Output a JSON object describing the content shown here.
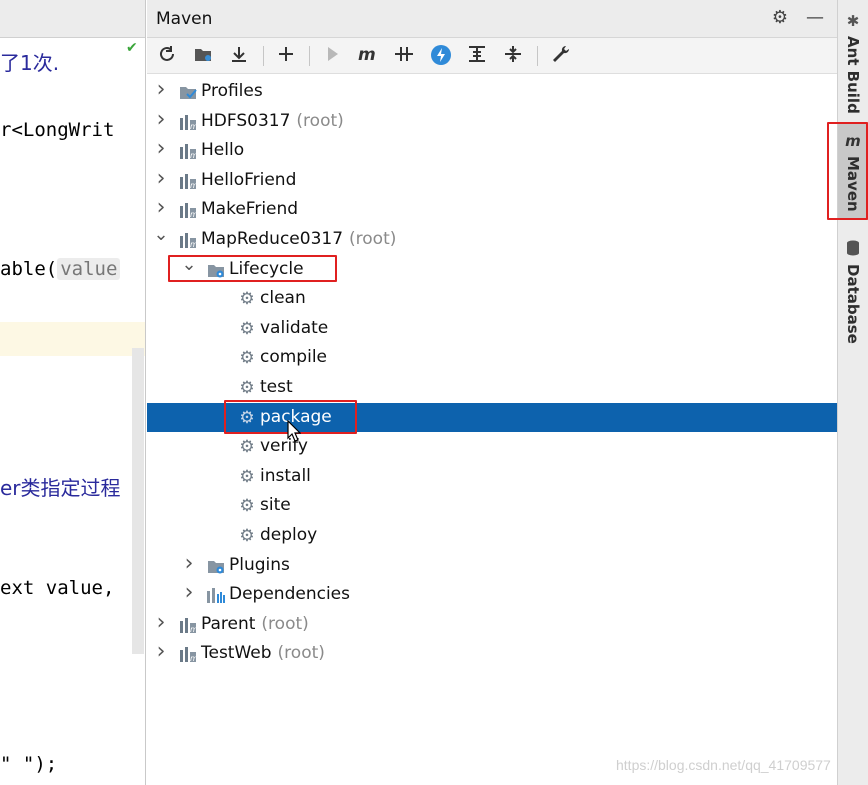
{
  "editor": {
    "lines": [
      {
        "text": "了1次.",
        "kind": "comment"
      },
      {
        "text": "r<LongWrit",
        "kind": "code"
      },
      {
        "text": "able(",
        "kind": "code",
        "hint": "value"
      },
      {
        "text": "er类指定过程",
        "kind": "comment"
      },
      {
        "text": "ext value,",
        "kind": "code"
      },
      {
        "text": "\" \");",
        "kind": "code"
      }
    ]
  },
  "maven": {
    "title": "Maven",
    "header_buttons": [
      {
        "name": "settings-gear-icon",
        "glyph": "⚙"
      },
      {
        "name": "hide-icon",
        "glyph": "—"
      }
    ],
    "toolbar": [
      {
        "name": "reimport-icon",
        "glyph": "⟳"
      },
      {
        "name": "generate-sources-icon",
        "glyph": "▣"
      },
      {
        "name": "download-icon",
        "glyph": "⤓"
      },
      {
        "name": "add-maven-project-icon",
        "glyph": "+"
      },
      {
        "name": "run-icon",
        "glyph": "▶"
      },
      {
        "name": "execute-goal-icon",
        "glyph": "m"
      },
      {
        "name": "toggle-offline-icon",
        "glyph": "⧸⧸"
      },
      {
        "name": "skip-tests-icon",
        "glyph": "⚡"
      },
      {
        "name": "show-dependencies-icon",
        "glyph": "⊤"
      },
      {
        "name": "collapse-all-icon",
        "glyph": "≑"
      },
      {
        "name": "maven-settings-icon",
        "glyph": "🔧"
      }
    ],
    "tree": [
      {
        "label": "Profiles",
        "suffix": "",
        "level": 0,
        "arrow": "›",
        "icon": "profiles"
      },
      {
        "label": "HDFS0317",
        "suffix": "(root)",
        "level": 0,
        "arrow": "›",
        "icon": "module"
      },
      {
        "label": "Hello",
        "suffix": "",
        "level": 0,
        "arrow": "›",
        "icon": "module"
      },
      {
        "label": "HelloFriend",
        "suffix": "",
        "level": 0,
        "arrow": "›",
        "icon": "module"
      },
      {
        "label": "MakeFriend",
        "suffix": "",
        "level": 0,
        "arrow": "›",
        "icon": "module"
      },
      {
        "label": "MapReduce0317",
        "suffix": "(root)",
        "level": 0,
        "arrow": "⌄",
        "icon": "module"
      },
      {
        "label": "Lifecycle",
        "suffix": "",
        "level": 1,
        "arrow": "⌄",
        "icon": "folder-gear"
      },
      {
        "label": "clean",
        "suffix": "",
        "level": 2,
        "arrow": "",
        "icon": "gear"
      },
      {
        "label": "validate",
        "suffix": "",
        "level": 2,
        "arrow": "",
        "icon": "gear"
      },
      {
        "label": "compile",
        "suffix": "",
        "level": 2,
        "arrow": "",
        "icon": "gear"
      },
      {
        "label": "test",
        "suffix": "",
        "level": 2,
        "arrow": "",
        "icon": "gear"
      },
      {
        "label": "package",
        "suffix": "",
        "level": 2,
        "arrow": "",
        "icon": "gear",
        "selected": true
      },
      {
        "label": "verify",
        "suffix": "",
        "level": 2,
        "arrow": "",
        "icon": "gear"
      },
      {
        "label": "install",
        "suffix": "",
        "level": 2,
        "arrow": "",
        "icon": "gear"
      },
      {
        "label": "site",
        "suffix": "",
        "level": 2,
        "arrow": "",
        "icon": "gear"
      },
      {
        "label": "deploy",
        "suffix": "",
        "level": 2,
        "arrow": "",
        "icon": "gear"
      },
      {
        "label": "Plugins",
        "suffix": "",
        "level": 1,
        "arrow": "›",
        "icon": "folder-gear"
      },
      {
        "label": "Dependencies",
        "suffix": "",
        "level": 1,
        "arrow": "›",
        "icon": "dependencies"
      },
      {
        "label": "Parent",
        "suffix": "(root)",
        "level": 0,
        "arrow": "›",
        "icon": "module"
      },
      {
        "label": "TestWeb",
        "suffix": "(root)",
        "level": 0,
        "arrow": "›",
        "icon": "module"
      }
    ]
  },
  "right_strip": {
    "tabs": [
      {
        "label": "Ant Build",
        "icon": "ant-icon",
        "active": false
      },
      {
        "label": "Maven",
        "icon": "maven-m-icon",
        "active": true
      },
      {
        "label": "Database",
        "icon": "database-icon",
        "active": false
      }
    ]
  },
  "colors": {
    "selection": "#0d62ad",
    "highlight_box": "#e02020"
  },
  "watermark": "https://blog.csdn.net/qq_41709577"
}
